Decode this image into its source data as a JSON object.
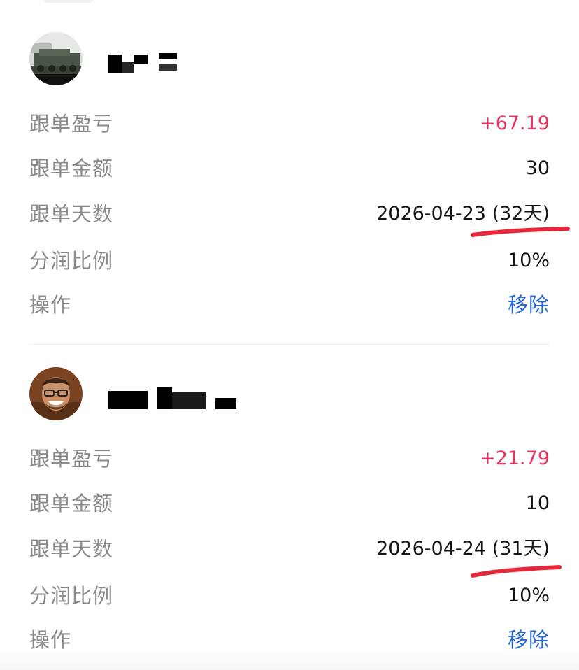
{
  "followers": [
    {
      "avatar_icon": "military-vehicle-photo-avatar",
      "name": "",
      "rows": [
        {
          "label": "跟单盈亏",
          "value": "+67.19",
          "tone": "positive"
        },
        {
          "label": "跟单金额",
          "value": "30",
          "tone": "normal"
        },
        {
          "label": "跟单天数",
          "value": "2026-04-23 (32天)",
          "tone": "normal"
        },
        {
          "label": "分润比例",
          "value": "10%",
          "tone": "normal"
        },
        {
          "label": "操作",
          "value": "移除",
          "tone": "link"
        }
      ]
    },
    {
      "avatar_icon": "smiling-man-glasses-avatar",
      "name": "",
      "rows": [
        {
          "label": "跟单盈亏",
          "value": "+21.79",
          "tone": "positive"
        },
        {
          "label": "跟单金额",
          "value": "10",
          "tone": "normal"
        },
        {
          "label": "跟单天数",
          "value": "2026-04-24 (31天)",
          "tone": "normal"
        },
        {
          "label": "分润比例",
          "value": "10%",
          "tone": "normal"
        },
        {
          "label": "操作",
          "value": "移除",
          "tone": "link"
        }
      ]
    }
  ],
  "colors": {
    "label": "#8a8a8f",
    "value": "#151515",
    "positive": "#e8335e",
    "link": "#2466d4",
    "annotation": "#e6283c"
  }
}
